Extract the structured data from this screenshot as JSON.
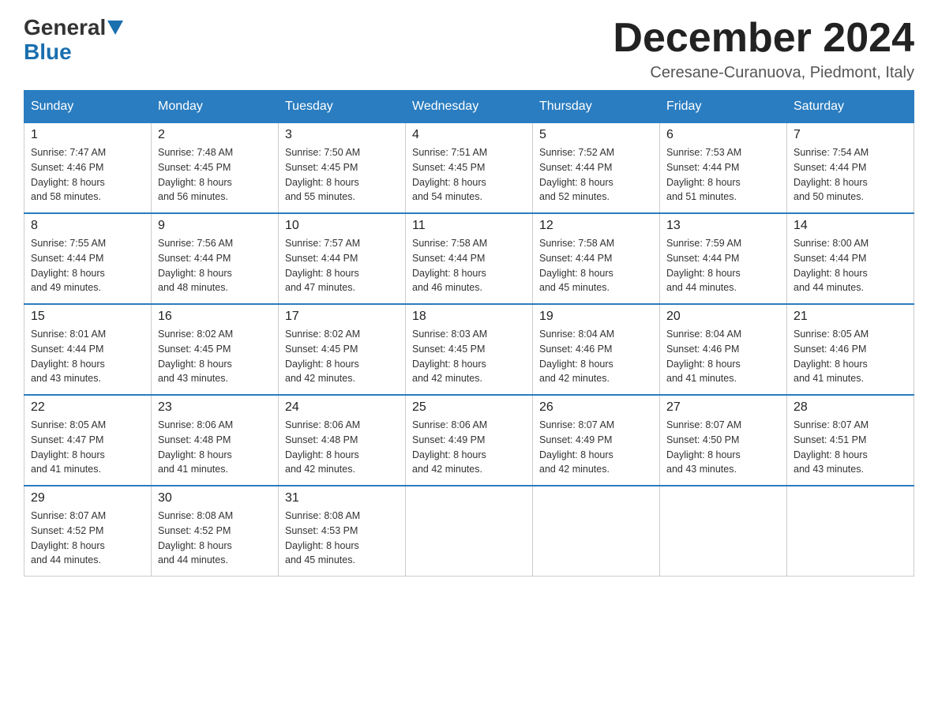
{
  "logo": {
    "general": "General",
    "blue": "Blue"
  },
  "header": {
    "month_year": "December 2024",
    "location": "Ceresane-Curanuova, Piedmont, Italy"
  },
  "weekdays": [
    "Sunday",
    "Monday",
    "Tuesday",
    "Wednesday",
    "Thursday",
    "Friday",
    "Saturday"
  ],
  "weeks": [
    [
      {
        "day": "1",
        "sunrise": "7:47 AM",
        "sunset": "4:46 PM",
        "daylight": "8 hours and 58 minutes."
      },
      {
        "day": "2",
        "sunrise": "7:48 AM",
        "sunset": "4:45 PM",
        "daylight": "8 hours and 56 minutes."
      },
      {
        "day": "3",
        "sunrise": "7:50 AM",
        "sunset": "4:45 PM",
        "daylight": "8 hours and 55 minutes."
      },
      {
        "day": "4",
        "sunrise": "7:51 AM",
        "sunset": "4:45 PM",
        "daylight": "8 hours and 54 minutes."
      },
      {
        "day": "5",
        "sunrise": "7:52 AM",
        "sunset": "4:44 PM",
        "daylight": "8 hours and 52 minutes."
      },
      {
        "day": "6",
        "sunrise": "7:53 AM",
        "sunset": "4:44 PM",
        "daylight": "8 hours and 51 minutes."
      },
      {
        "day": "7",
        "sunrise": "7:54 AM",
        "sunset": "4:44 PM",
        "daylight": "8 hours and 50 minutes."
      }
    ],
    [
      {
        "day": "8",
        "sunrise": "7:55 AM",
        "sunset": "4:44 PM",
        "daylight": "8 hours and 49 minutes."
      },
      {
        "day": "9",
        "sunrise": "7:56 AM",
        "sunset": "4:44 PM",
        "daylight": "8 hours and 48 minutes."
      },
      {
        "day": "10",
        "sunrise": "7:57 AM",
        "sunset": "4:44 PM",
        "daylight": "8 hours and 47 minutes."
      },
      {
        "day": "11",
        "sunrise": "7:58 AM",
        "sunset": "4:44 PM",
        "daylight": "8 hours and 46 minutes."
      },
      {
        "day": "12",
        "sunrise": "7:58 AM",
        "sunset": "4:44 PM",
        "daylight": "8 hours and 45 minutes."
      },
      {
        "day": "13",
        "sunrise": "7:59 AM",
        "sunset": "4:44 PM",
        "daylight": "8 hours and 44 minutes."
      },
      {
        "day": "14",
        "sunrise": "8:00 AM",
        "sunset": "4:44 PM",
        "daylight": "8 hours and 44 minutes."
      }
    ],
    [
      {
        "day": "15",
        "sunrise": "8:01 AM",
        "sunset": "4:44 PM",
        "daylight": "8 hours and 43 minutes."
      },
      {
        "day": "16",
        "sunrise": "8:02 AM",
        "sunset": "4:45 PM",
        "daylight": "8 hours and 43 minutes."
      },
      {
        "day": "17",
        "sunrise": "8:02 AM",
        "sunset": "4:45 PM",
        "daylight": "8 hours and 42 minutes."
      },
      {
        "day": "18",
        "sunrise": "8:03 AM",
        "sunset": "4:45 PM",
        "daylight": "8 hours and 42 minutes."
      },
      {
        "day": "19",
        "sunrise": "8:04 AM",
        "sunset": "4:46 PM",
        "daylight": "8 hours and 42 minutes."
      },
      {
        "day": "20",
        "sunrise": "8:04 AM",
        "sunset": "4:46 PM",
        "daylight": "8 hours and 41 minutes."
      },
      {
        "day": "21",
        "sunrise": "8:05 AM",
        "sunset": "4:46 PM",
        "daylight": "8 hours and 41 minutes."
      }
    ],
    [
      {
        "day": "22",
        "sunrise": "8:05 AM",
        "sunset": "4:47 PM",
        "daylight": "8 hours and 41 minutes."
      },
      {
        "day": "23",
        "sunrise": "8:06 AM",
        "sunset": "4:48 PM",
        "daylight": "8 hours and 41 minutes."
      },
      {
        "day": "24",
        "sunrise": "8:06 AM",
        "sunset": "4:48 PM",
        "daylight": "8 hours and 42 minutes."
      },
      {
        "day": "25",
        "sunrise": "8:06 AM",
        "sunset": "4:49 PM",
        "daylight": "8 hours and 42 minutes."
      },
      {
        "day": "26",
        "sunrise": "8:07 AM",
        "sunset": "4:49 PM",
        "daylight": "8 hours and 42 minutes."
      },
      {
        "day": "27",
        "sunrise": "8:07 AM",
        "sunset": "4:50 PM",
        "daylight": "8 hours and 43 minutes."
      },
      {
        "day": "28",
        "sunrise": "8:07 AM",
        "sunset": "4:51 PM",
        "daylight": "8 hours and 43 minutes."
      }
    ],
    [
      {
        "day": "29",
        "sunrise": "8:07 AM",
        "sunset": "4:52 PM",
        "daylight": "8 hours and 44 minutes."
      },
      {
        "day": "30",
        "sunrise": "8:08 AM",
        "sunset": "4:52 PM",
        "daylight": "8 hours and 44 minutes."
      },
      {
        "day": "31",
        "sunrise": "8:08 AM",
        "sunset": "4:53 PM",
        "daylight": "8 hours and 45 minutes."
      },
      null,
      null,
      null,
      null
    ]
  ],
  "labels": {
    "sunrise": "Sunrise:",
    "sunset": "Sunset:",
    "daylight": "Daylight:"
  }
}
